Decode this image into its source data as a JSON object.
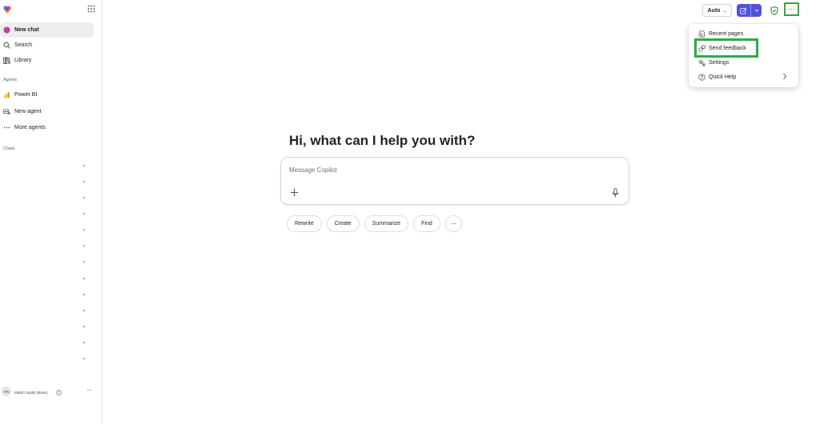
{
  "sidebar": {
    "nav": [
      {
        "label": "New chat",
        "icon": "copilot-chat-icon"
      },
      {
        "label": "Search",
        "icon": "search-icon"
      },
      {
        "label": "Library",
        "icon": "library-icon"
      }
    ],
    "agents_label": "Agents",
    "agents": [
      {
        "label": "Power BI",
        "icon": "power-bi-icon"
      },
      {
        "label": "New agent",
        "icon": "new-agent-icon"
      },
      {
        "label": "More agents",
        "icon": "more-horizontal-icon"
      }
    ],
    "chats_label": "Chats",
    "user": {
      "initials": "HN",
      "plan": "M365 Copilot (Basic)"
    }
  },
  "toolbar": {
    "model_label": "Auto",
    "more_label": "···"
  },
  "menu": {
    "items": [
      {
        "label": "Recent pages",
        "icon": "recent-pages-icon"
      },
      {
        "label": "Send feedback",
        "icon": "feedback-icon"
      },
      {
        "label": "Settings",
        "icon": "settings-icon"
      },
      {
        "label": "Quick Help",
        "icon": "help-icon"
      }
    ]
  },
  "main": {
    "greeting": "Hi, what can I help you with?",
    "composer_placeholder": "Message Copilot",
    "chips": [
      "Rewrite",
      "Create",
      "Summarize",
      "Find"
    ],
    "chips_more": "···"
  },
  "colors": {
    "accent": "#4f52e0",
    "highlight": "#2eaa45"
  }
}
